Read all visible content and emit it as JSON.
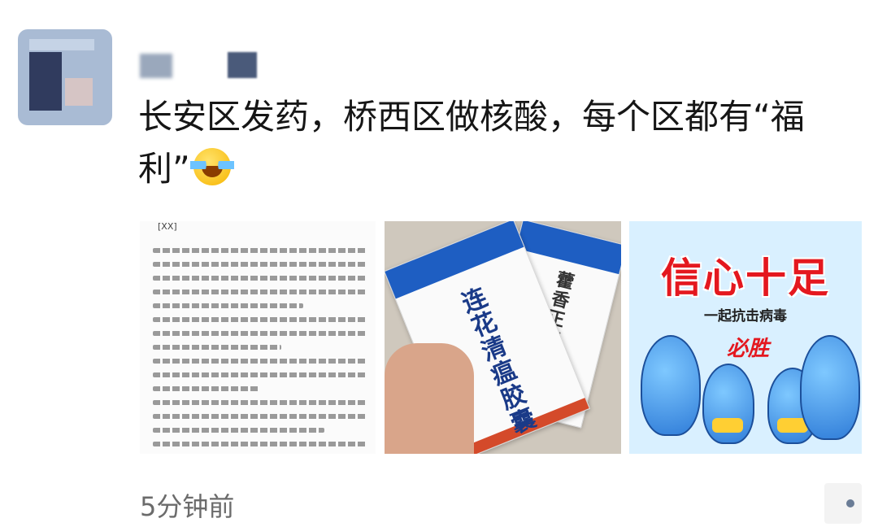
{
  "post": {
    "text": "长安区发药，桥西区做核酸，每个区都有“福利”",
    "emoji": "tears-of-joy-emoji"
  },
  "images": [
    {
      "type": "document-screenshot",
      "title": "[XX]"
    },
    {
      "type": "medicine-boxes-photo",
      "box_label_main": "连花清瘟胶囊",
      "box_label_second": "藿香正气软胶"
    },
    {
      "type": "poster",
      "title": "信心十足",
      "subtitle": "一起抗击病毒",
      "slogan": "必胜"
    }
  ],
  "footer": {
    "timestamp": "5分钟前"
  },
  "icons": {
    "more_actions": "comment-more-icon"
  }
}
